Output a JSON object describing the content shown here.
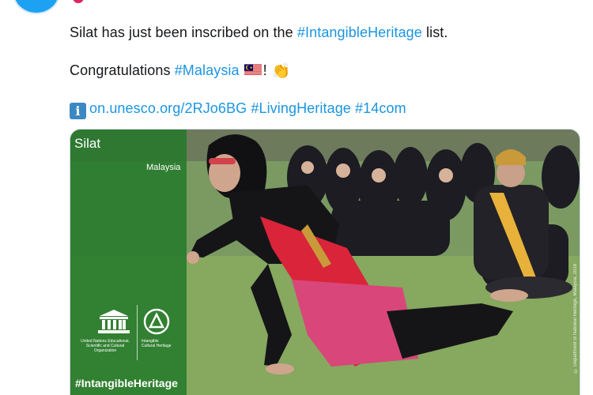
{
  "tweet": {
    "line1": {
      "text_before": "Silat has just been inscribed on the ",
      "hashtag": "#IntangibleHeritage",
      "text_after": " list."
    },
    "line2": {
      "text_before": "Congratulations ",
      "hashtag": "#Malaysia",
      "flag_icon": "malaysia-flag-icon",
      "exclamation": "!",
      "clap_icon": "clapping-hands-icon",
      "clap_glyph": "👏"
    },
    "line3": {
      "info_icon": "information-icon",
      "info_glyph": "i",
      "link": "on.unesco.org/2RJo6BG",
      "hashtag1": "#LivingHeritage",
      "hashtag2": "#14com"
    }
  },
  "media": {
    "panel_title": "Silat",
    "panel_country": "Malaysia",
    "unesco_caption": "United Nations Educational, Scientific and Cultural Organization",
    "ich_caption": "Intangible Cultural Heritage",
    "panel_hashtag": "#IntangibleHeritage",
    "credit": "© Department of National Heritage, Malaysia, 2018"
  },
  "colors": {
    "hashtag": "#1b95e0",
    "panel_green": "#207828",
    "avatar": "#1da1f2"
  }
}
